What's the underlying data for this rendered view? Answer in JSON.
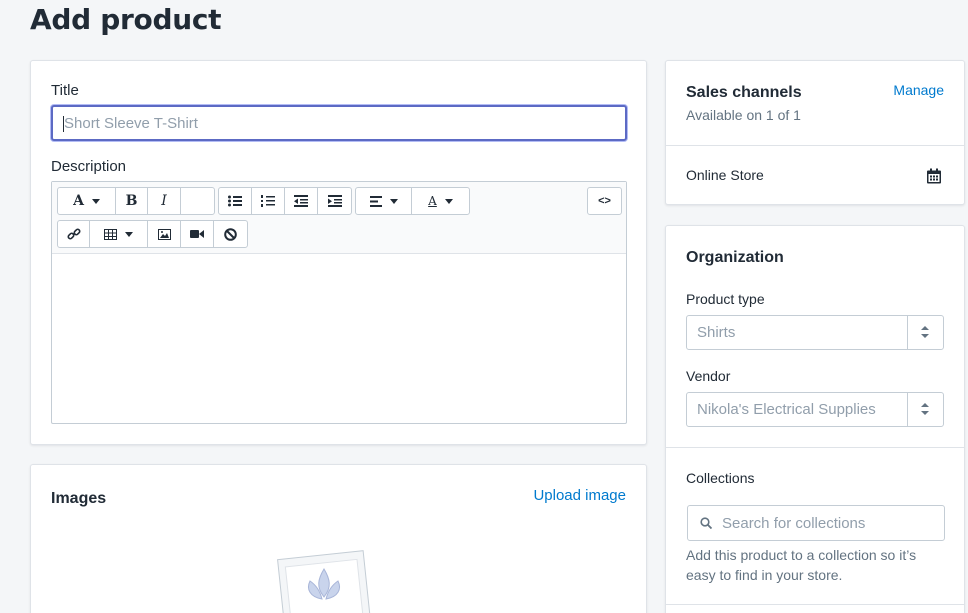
{
  "page": {
    "title": "Add product"
  },
  "product_card": {
    "title_label": "Title",
    "title_placeholder": "Short Sleeve T-Shirt",
    "description_label": "Description",
    "toolbar": {
      "bold": "B",
      "italic": "I",
      "font": "A",
      "color": "A",
      "html": "<>"
    }
  },
  "images_card": {
    "heading": "Images",
    "upload_link": "Upload image"
  },
  "sales_channels": {
    "heading": "Sales channels",
    "manage_link": "Manage",
    "availability": "Available on 1 of 1",
    "channel": "Online Store",
    "channel_icon": "calendar-icon"
  },
  "organization": {
    "heading": "Organization",
    "product_type_label": "Product type",
    "product_type_value": "Shirts",
    "vendor_label": "Vendor",
    "vendor_value": "Nikola's Electrical Supplies",
    "collections_label": "Collections",
    "collections_placeholder": "Search for collections",
    "collections_help": "Add this product to a collection so it’s easy to find in your store."
  },
  "colors": {
    "accent": "#5c6ac4",
    "link": "#007ace",
    "background": "#f4f6f8"
  }
}
